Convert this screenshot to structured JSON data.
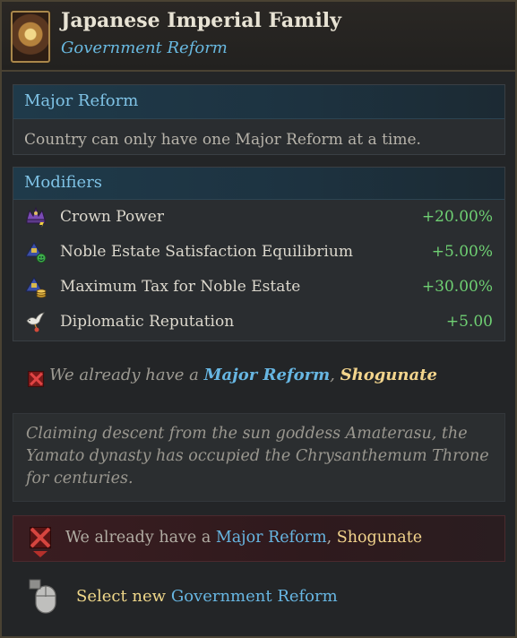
{
  "header": {
    "title": "Japanese Imperial Family",
    "subtitle": "Government Reform"
  },
  "major_reform": {
    "heading": "Major Reform",
    "text": "Country can only have one Major Reform at a time."
  },
  "modifiers": {
    "heading": "Modifiers",
    "items": [
      {
        "icon": "crown-power-icon",
        "label": "Crown Power",
        "value": "+20.00%"
      },
      {
        "icon": "noble-estate-satisfaction-icon",
        "label": "Noble Estate Satisfaction Equilibrium",
        "value": "+5.00%"
      },
      {
        "icon": "noble-estate-tax-icon",
        "label": "Maximum Tax for Noble Estate",
        "value": "+30.00%"
      },
      {
        "icon": "dove-icon",
        "label": "Diplomatic Reputation",
        "value": "+5.00"
      }
    ]
  },
  "requirement": {
    "prefix": "We already have a ",
    "reform_type": "Major Reform",
    "comma": ", ",
    "reform_name": "Shogunate"
  },
  "description": "Claiming descent from the sun goddess Amaterasu, the Yamato dynasty has occupied the Chrysanthemum Throne for centuries.",
  "blocked": {
    "prefix": "We already have a ",
    "reform_type": "Major Reform",
    "comma": ", ",
    "reform_name": "Shogunate"
  },
  "action": {
    "prefix": "Select new ",
    "target": "Government Reform"
  },
  "colors": {
    "accent_blue": "#67b6e2",
    "positive_green": "#6fd073",
    "gold": "#f2d48c",
    "blocked_red": "#d6453f"
  }
}
